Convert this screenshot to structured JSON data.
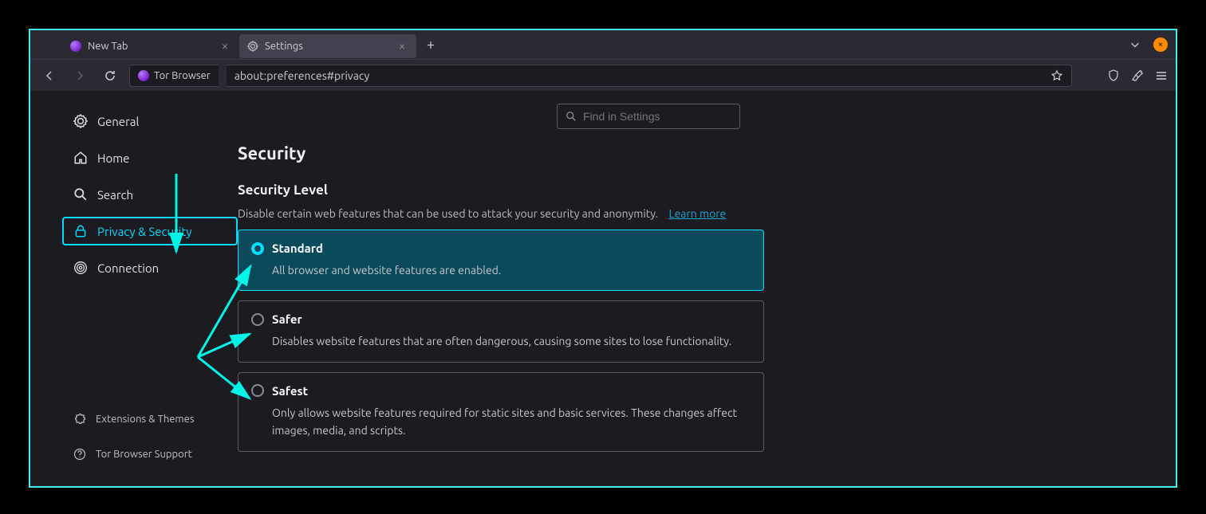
{
  "titlebar": {
    "tabs": [
      {
        "label": "New Tab",
        "active": false
      },
      {
        "label": "Settings",
        "active": true
      }
    ]
  },
  "toolbar": {
    "identity_label": "Tor Browser",
    "url": "about:preferences#privacy"
  },
  "search": {
    "placeholder": "Find in Settings"
  },
  "sidebar": {
    "items": [
      {
        "label": "General"
      },
      {
        "label": "Home"
      },
      {
        "label": "Search"
      },
      {
        "label": "Privacy & Security"
      },
      {
        "label": "Connection"
      }
    ],
    "footer": [
      {
        "label": "Extensions & Themes"
      },
      {
        "label": "Tor Browser Support"
      }
    ]
  },
  "security": {
    "heading": "Security",
    "sub": "Security Level",
    "desc": "Disable certain web features that can be used to attack your security and anonymity.",
    "learn": "Learn more",
    "options": [
      {
        "title": "Standard",
        "desc": "All browser and website features are enabled.",
        "selected": true
      },
      {
        "title": "Safer",
        "desc": "Disables website features that are often dangerous, causing some sites to lose functionality.",
        "selected": false
      },
      {
        "title": "Safest",
        "desc": "Only allows website features required for static sites and basic services. These changes affect images, media, and scripts.",
        "selected": false
      }
    ]
  }
}
